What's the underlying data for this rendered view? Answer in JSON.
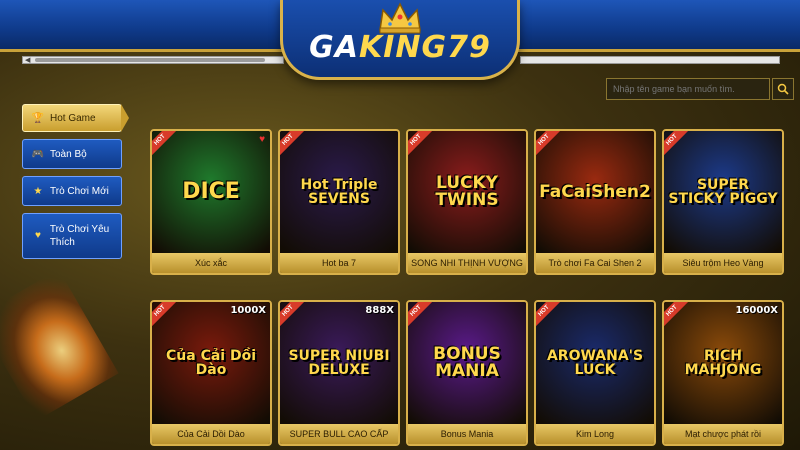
{
  "brand": {
    "prefix": "GA",
    "suffix": "KING79"
  },
  "search": {
    "placeholder": "Nhập tên game bạn muốn tìm."
  },
  "sidebar": {
    "items": [
      {
        "label": "Hot Game",
        "icon": "trophy-icon",
        "active": true
      },
      {
        "label": "Toàn Bộ",
        "icon": "gamepad-icon",
        "active": false
      },
      {
        "label": "Trò Chơi Mới",
        "icon": "star-icon",
        "active": false
      },
      {
        "label": "Trò Chơi Yêu Thích",
        "icon": "heart-icon",
        "active": false
      }
    ]
  },
  "games": [
    {
      "name": "Xúc xắc",
      "art": "DICE",
      "badge": "HOT",
      "favorite": true,
      "color": "#1f7a2c"
    },
    {
      "name": "Hot ba 7",
      "art": "Hot Triple SEVENS",
      "badge": "HOT",
      "favorite": false,
      "color": "#2a1a4a"
    },
    {
      "name": "SONG NHI THỊNH VƯỢNG",
      "art": "LUCKY TWINS",
      "badge": "HOT",
      "favorite": false,
      "color": "#8a1c1c"
    },
    {
      "name": "Trò chơi Fa Cai Shen 2",
      "art": "FaCaiShen2",
      "badge": "HOT",
      "favorite": false,
      "color": "#9a2a10"
    },
    {
      "name": "Siêu trộm Heo Vàng",
      "art": "SUPER STICKY PIGGY",
      "badge": "HOT",
      "favorite": false,
      "color": "#1c3a8a"
    },
    {
      "name": "Của Cải Dồi Dào",
      "art": "Của Cải Dồi Dào",
      "badge": "HOT",
      "favorite": false,
      "color": "#7a1a0c",
      "tag": "1000X"
    },
    {
      "name": "SUPER BULL CAO CẤP",
      "art": "SUPER NIUBI DELUXE",
      "badge": "HOT",
      "favorite": false,
      "color": "#3a1a5a",
      "tag": "888X"
    },
    {
      "name": "Bonus Mania",
      "art": "BONUS MANIA",
      "badge": "HOT",
      "favorite": false,
      "color": "#5a1a8a"
    },
    {
      "name": "Kim Long",
      "art": "AROWANA'S LUCK",
      "badge": "HOT",
      "favorite": false,
      "color": "#1a2a6a"
    },
    {
      "name": "Mạt chược phát rồi",
      "art": "RICH MAHJONG",
      "badge": "HOT",
      "favorite": false,
      "color": "#8a4a0a",
      "tag": "16000X"
    }
  ]
}
